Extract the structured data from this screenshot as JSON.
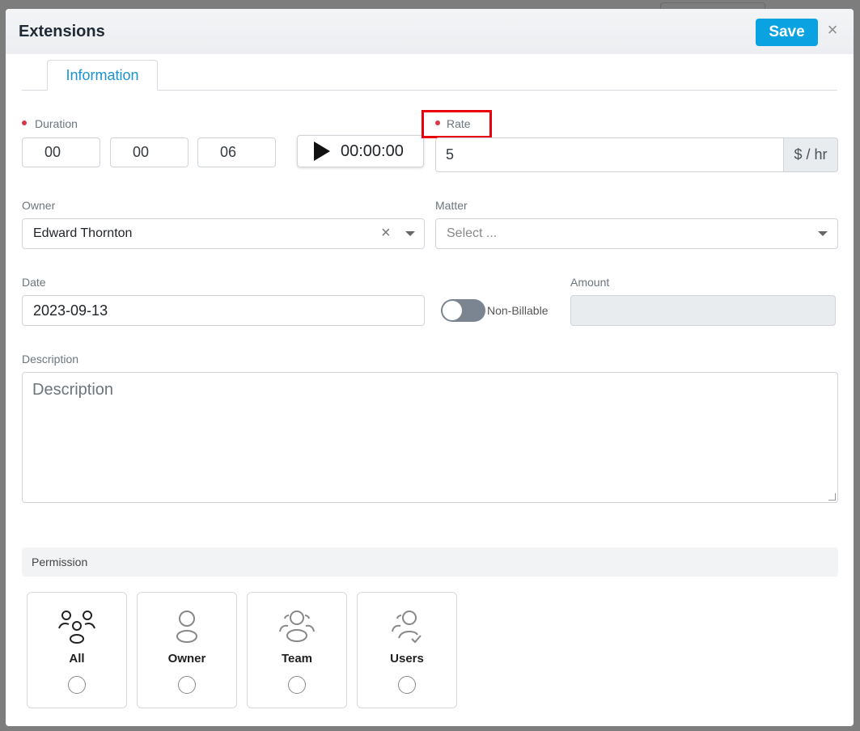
{
  "modal": {
    "title": "Extensions",
    "save_label": "Save",
    "close_glyph": "×"
  },
  "tabs": [
    {
      "label": "Information",
      "active": true
    }
  ],
  "duration": {
    "label": "Duration",
    "hours": "00",
    "minutes": "00",
    "seconds": "06"
  },
  "timer": {
    "display": "00:00:00"
  },
  "rate": {
    "label": "Rate",
    "value": "5",
    "unit": "$ / hr"
  },
  "owner": {
    "label": "Owner",
    "value": "Edward Thornton",
    "clear_glyph": "×"
  },
  "matter": {
    "label": "Matter",
    "placeholder": "Select ..."
  },
  "date": {
    "label": "Date",
    "value": "2023-09-13"
  },
  "billing": {
    "toggle_label": "Non-Billable",
    "billable": false
  },
  "amount": {
    "label": "Amount",
    "value": ""
  },
  "description": {
    "label": "Description",
    "placeholder": "Description"
  },
  "permission": {
    "header": "Permission",
    "options": [
      {
        "label": "All",
        "icon": "group-all-icon"
      },
      {
        "label": "Owner",
        "icon": "person-icon"
      },
      {
        "label": "Team",
        "icon": "team-icon"
      },
      {
        "label": "Users",
        "icon": "users-check-icon"
      }
    ]
  },
  "colors": {
    "accent": "#0aa2e0",
    "tab_text": "#1a93d3",
    "required_dot": "#dc3545",
    "highlight": "#e8000b"
  }
}
